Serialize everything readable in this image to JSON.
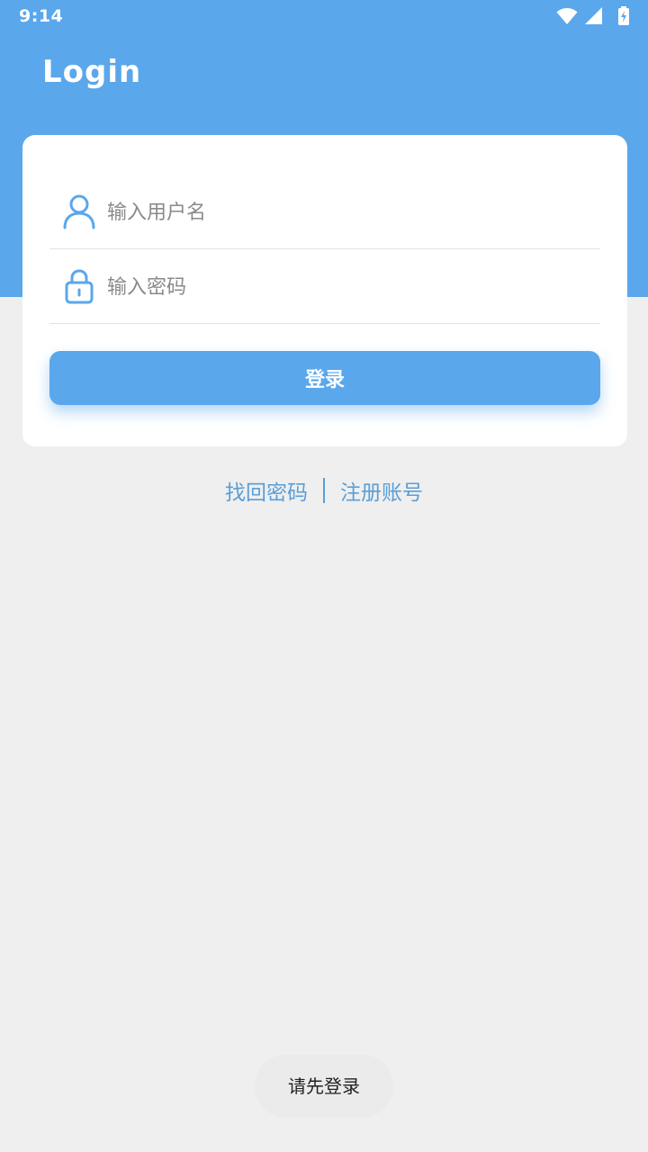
{
  "status_bar": {
    "time": "9:14",
    "icons": [
      "wifi-icon",
      "cell-signal-icon",
      "battery-charging-icon"
    ]
  },
  "header": {
    "title": "Login",
    "background_color": "#5aa7ec"
  },
  "form": {
    "username": {
      "placeholder": "输入用户名",
      "value": "",
      "icon": "user-icon"
    },
    "password": {
      "placeholder": "输入密码",
      "value": "",
      "icon": "lock-icon"
    },
    "login_button_label": "登录"
  },
  "links": {
    "forgot_password": "找回密码",
    "register": "注册账号"
  },
  "toast": {
    "message": "请先登录"
  },
  "colors": {
    "accent": "#5aa7ec",
    "link": "#5b9ed6",
    "page_background": "#efefef"
  }
}
